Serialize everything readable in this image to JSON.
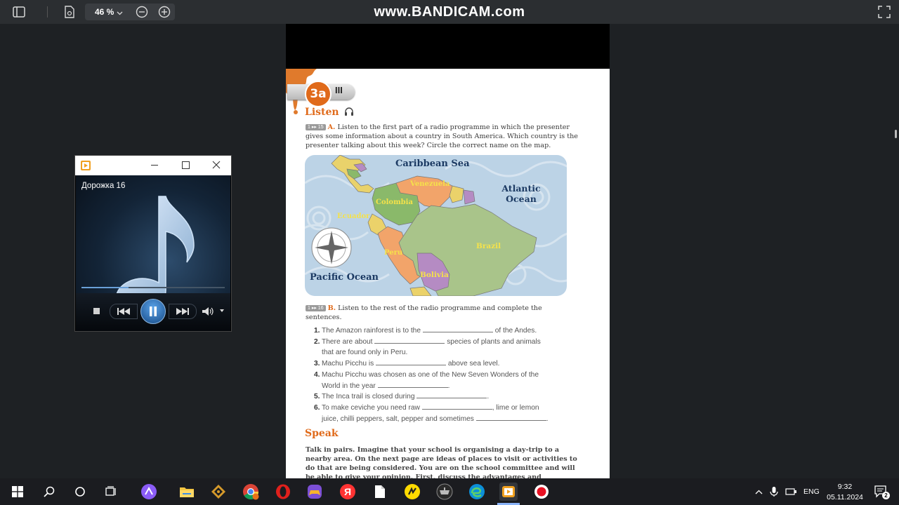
{
  "toolbar": {
    "zoom": "46 %",
    "watermark_prefix": "www.",
    "watermark_brand": "BANDICAM",
    "watermark_suffix": ".com"
  },
  "document": {
    "unit": "3a",
    "unit_roman": "III",
    "listen_title": "Listen",
    "exercise_a_label": "A.",
    "exercise_a_track": "1 ▸▸ 15",
    "exercise_a_text": "Listen to the first part of a radio programme in which the presenter gives some information about a country in South America. Which country is the presenter talking about this week? Circle the correct name on the map.",
    "map_labels": {
      "caribbean": "Caribbean Sea",
      "atlantic": "Atlantic Ocean",
      "pacific": "Pacific Ocean",
      "venezuela": "Venezuela",
      "colombia": "Colombia",
      "ecuador": "Ecuador",
      "peru": "Peru",
      "brazil": "Brazil",
      "bolivia": "Bolivia"
    },
    "exercise_b_label": "B.",
    "exercise_b_track": "1 ▸▸ 16",
    "exercise_b_text": "Listen to the rest of the radio programme and complete the sentences.",
    "sentences": [
      {
        "num": "1.",
        "a": "The Amazon rainforest is to the",
        "b": "of the Andes.",
        "c": ""
      },
      {
        "num": "2.",
        "a": "There are about",
        "b": "species of plants and animals",
        "c": "that are found only in Peru."
      },
      {
        "num": "3.",
        "a": "Machu Picchu is",
        "b": "above sea level.",
        "c": ""
      },
      {
        "num": "4.",
        "a": "Machu Picchu was chosen as one of the New Seven Wonders of the",
        "b": "",
        "c": "World in the year"
      },
      {
        "num": "5.",
        "a": "The Inca trail is closed during",
        "b": ".",
        "c": ""
      },
      {
        "num": "6.",
        "a": "To make ceviche you need raw",
        "b": ", lime or lemon",
        "c": "juice, chilli peppers, salt, pepper and sometimes"
      }
    ],
    "speak_title": "Speak",
    "speak_text": "Talk in pairs. Imagine that your school is organising a day-trip to a nearby area. On the next page are ideas of places to visit or activities to do that are being considered. You are on the school committee and will be able to give your opinion. First, discuss the advantages and"
  },
  "player": {
    "track_title": "Дорожка 16",
    "progress": 0.33
  },
  "taskbar": {
    "language": "ENG",
    "time": "9:32",
    "date": "05.11.2024",
    "notification_count": "2"
  }
}
